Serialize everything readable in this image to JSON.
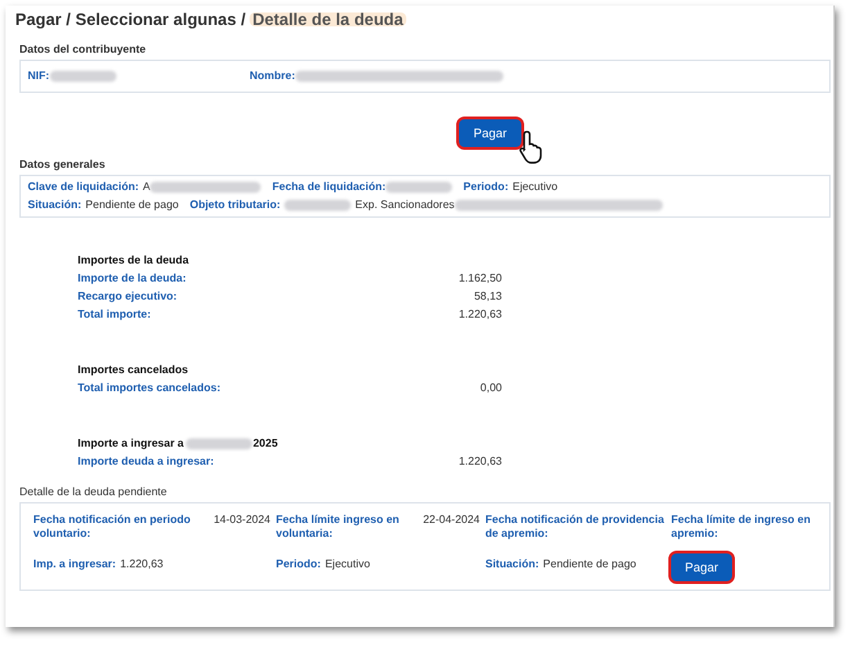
{
  "breadcrumb": {
    "path": "Pagar / Seleccionar algunas /",
    "current": "Detalle de la deuda"
  },
  "contribuyente": {
    "title": "Datos del contribuyente",
    "fields": [
      {
        "label": "NIF:",
        "redacted": true
      },
      {
        "label": "Nombre:",
        "redacted": true
      }
    ]
  },
  "top_button": {
    "label": "Pagar",
    "highlighted": true
  },
  "generales": {
    "title": "Datos generales",
    "rows": [
      [
        {
          "label": "Clave de liquidación:",
          "value": "A",
          "redacted": true
        },
        {
          "label": "Fecha de liquidación:",
          "redacted": true
        },
        {
          "label": "Periodo:",
          "value": "Ejecutivo"
        }
      ],
      [
        {
          "label": "Situación:",
          "value": "Pendiente de pago"
        },
        {
          "label": "Objeto tributario:",
          "redacted_before": true,
          "value": "Exp. Sancionadores",
          "redacted": true
        }
      ]
    ]
  },
  "importes": [
    {
      "title": "Importes de la deuda",
      "rows": [
        {
          "label": "Importe de la deuda:",
          "value": "1.162,50"
        },
        {
          "label": "Recargo ejecutivo:",
          "value": "58,13"
        },
        {
          "label": "Total importe:",
          "value": "1.220,63"
        }
      ]
    },
    {
      "title": "Importes cancelados",
      "rows": [
        {
          "label": "Total importes cancelados:",
          "value": "0,00"
        }
      ]
    },
    {
      "title": "Importe a ingresar a",
      "title_redacted": true,
      "title_after": "2025",
      "rows": [
        {
          "label": "Importe deuda a ingresar:",
          "value": "1.220,63"
        }
      ]
    }
  ],
  "pendiente": {
    "title": "Detalle de la deuda pendiente",
    "columns": [
      {
        "label": "Fecha notificación en periodo voluntario:",
        "value": "14-03-2024",
        "bottom": {
          "label": "Imp. a ingresar:",
          "value": "1.220,63"
        }
      },
      {
        "label": "Fecha límite ingreso en voluntaria:",
        "value": "22-04-2024",
        "bottom": {
          "label": "Periodo:",
          "value": "Ejecutivo"
        }
      },
      {
        "label": "Fecha notificación de providencia de apremio:",
        "bottom": {
          "label": "Situación:",
          "value": "Pendiente de pago"
        }
      },
      {
        "label": "Fecha límite de ingreso en apremio:",
        "button": {
          "label": "Pagar",
          "highlighted": true
        }
      }
    ]
  }
}
